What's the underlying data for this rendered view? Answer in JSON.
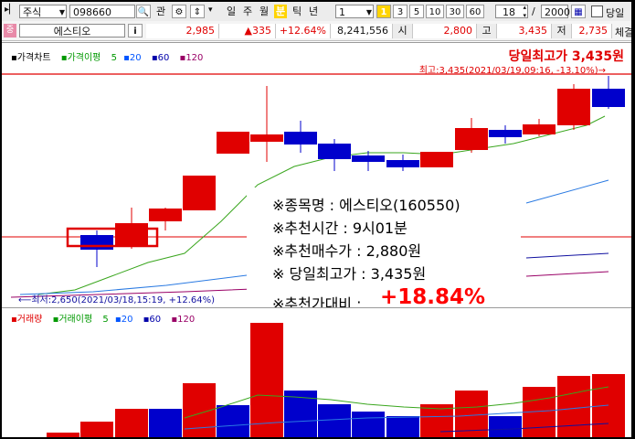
{
  "toolbar": {
    "market": "주식",
    "code": "098660",
    "watch_label": "관",
    "period_buttons": [
      "일",
      "주",
      "월",
      "분",
      "틱",
      "년"
    ],
    "active_period": "분",
    "interval_value": "1",
    "minute_buttons": [
      "1",
      "3",
      "5",
      "10",
      "30",
      "60"
    ],
    "count_value": "18",
    "bars_value": "2000",
    "same_day_label": "당일"
  },
  "quote_bar": {
    "stock_name": "에스티오",
    "info_label": "i",
    "price": "2,985",
    "change": "▲335",
    "change_rate": "+12.64%",
    "volume": "8,241,556",
    "open_label": "시",
    "open": "2,800",
    "high_label": "고",
    "high": "3,435",
    "low_label": "저",
    "low": "2,735",
    "exec_label": "체결"
  },
  "price_chart": {
    "legend": [
      {
        "label": "가격차트",
        "color": "#000000"
      },
      {
        "label": "가격이평",
        "color": "#009900"
      },
      {
        "label": "5",
        "color": "#009900"
      },
      {
        "label": "20",
        "color": "#0055ff"
      },
      {
        "label": "60",
        "color": "#0000aa"
      },
      {
        "label": "120",
        "color": "#990066"
      }
    ],
    "day_high_banner": "당일최고가 3,435원",
    "high_annotation": "최고:3,435(2021/03/19,09:16, -13.10%)→",
    "low_annotation": "⟵최저:2,650(2021/03/18,15:19, +12.64%)"
  },
  "volume_chart": {
    "legend": [
      {
        "label": "거래량",
        "color": "#e00000"
      },
      {
        "label": "거래이평",
        "color": "#009900"
      },
      {
        "label": "5",
        "color": "#009900"
      },
      {
        "label": "20",
        "color": "#0055ff"
      },
      {
        "label": "60",
        "color": "#0000aa"
      },
      {
        "label": "120",
        "color": "#990066"
      }
    ]
  },
  "recommendation": {
    "name_line": "※종목명 :  에스티오(160550)",
    "time_line": "※추천시간 : 9시01분",
    "buy_line": "※추천매수가 : 2,880원",
    "high_line": "※ 당일최고가 : 3,435원",
    "ratio_label": "※추천가대비 :",
    "ratio_value": "+18.84%"
  },
  "colors": {
    "up": "#e00000",
    "down": "#0000cc",
    "accent_red": "#ff0000"
  }
}
